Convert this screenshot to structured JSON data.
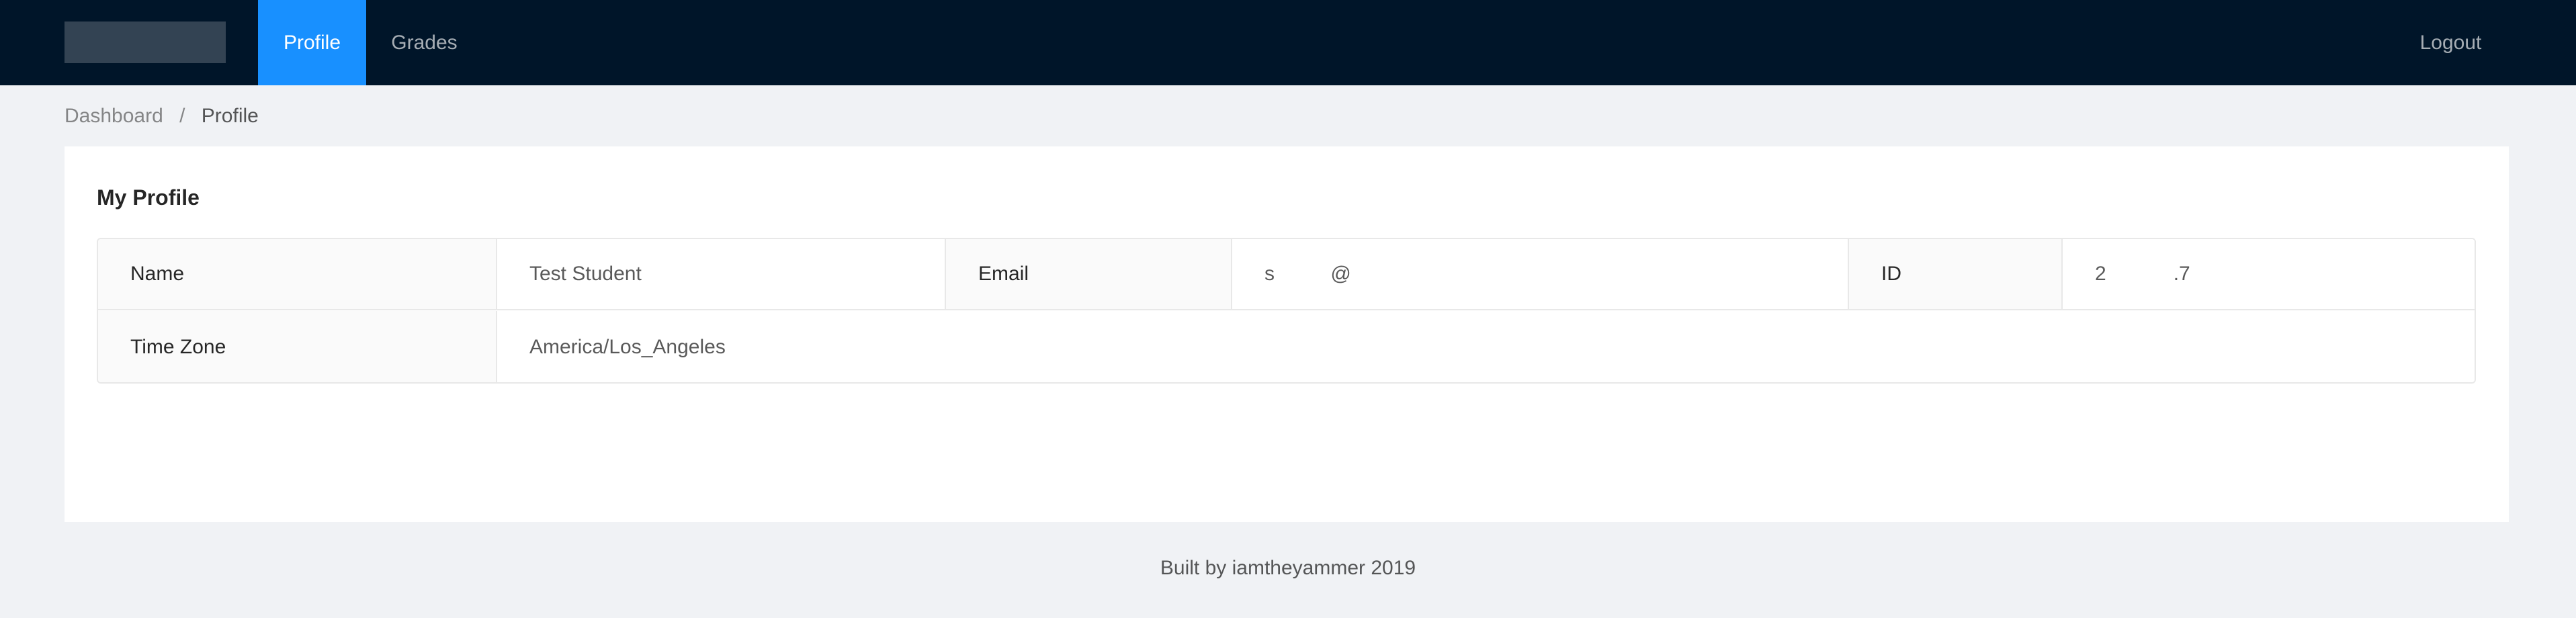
{
  "header": {
    "nav": {
      "profile": "Profile",
      "grades": "Grades",
      "logout": "Logout"
    },
    "active_item": "Profile"
  },
  "breadcrumb": {
    "items": [
      "Dashboard",
      "Profile"
    ],
    "separator": "/"
  },
  "profile": {
    "title": "My Profile",
    "fields": {
      "name_label": "Name",
      "name_value": "Test Student",
      "email_label": "Email",
      "email_value": "s          @",
      "id_label": "ID",
      "id_value": "2            .7",
      "timezone_label": "Time Zone",
      "timezone_value": "America/Los_Angeles"
    }
  },
  "footer": {
    "text": "Built by iamtheyammer 2019"
  },
  "colors": {
    "header_bg": "#001529",
    "accent": "#1890ff",
    "page_bg": "#f0f2f5",
    "card_bg": "#ffffff",
    "label_bg": "#fafafa",
    "border": "#e8e8e8"
  }
}
